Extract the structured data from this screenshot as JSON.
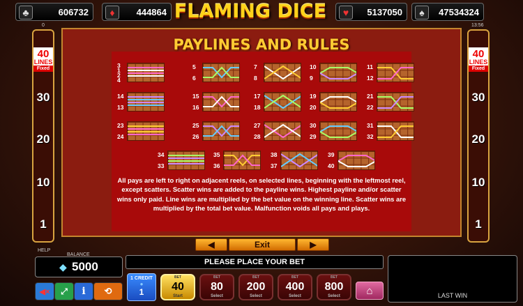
{
  "top": {
    "jackpots": [
      {
        "icon": "club-icon",
        "value": "606732"
      },
      {
        "icon": "diamond-icon",
        "value": "444864"
      },
      {
        "icon": "heart-icon",
        "value": "5137050"
      },
      {
        "icon": "spade-icon",
        "value": "47534324"
      }
    ],
    "title": "FLAMING DICE",
    "left_small": "0",
    "clock": "13:56"
  },
  "sides": {
    "lines": "40",
    "lines_label": "LINES",
    "fixed": "Fixed",
    "levels": [
      "30",
      "20",
      "10",
      "1"
    ]
  },
  "panel": {
    "title": "PAYLINES AND RULES",
    "rules": "All pays are left to right on adjacent reels, on selected lines, beginning with the leftmost reel, except scatters. Scatter wins are added to the payline wins. Highest payline and/or scatter wins only paid. Line wins are multiplied by the bet value on the winning line. Scatter wins are multiplied by the total bet value. Malfunction voids all pays and plays.",
    "paylines": [
      {
        "labels": [
          "3",
          "1",
          "2",
          "4"
        ]
      },
      {
        "labels": [
          "5",
          "6"
        ]
      },
      {
        "labels": [
          "7",
          "8"
        ]
      },
      {
        "labels": [
          "10",
          "9"
        ]
      },
      {
        "labels": [
          "11",
          "12"
        ]
      },
      {
        "labels": [
          "14",
          "13"
        ]
      },
      {
        "labels": [
          "15",
          "16"
        ]
      },
      {
        "labels": [
          "17",
          "18"
        ]
      },
      {
        "labels": [
          "19",
          "20"
        ]
      },
      {
        "labels": [
          "21",
          "22"
        ]
      },
      {
        "labels": [
          "23",
          "24"
        ]
      },
      {
        "labels": [
          "25",
          "26"
        ]
      },
      {
        "labels": [
          "27",
          "28"
        ]
      },
      {
        "labels": [
          "30",
          "29"
        ]
      },
      {
        "labels": [
          "31",
          "32"
        ]
      },
      {
        "labels": [
          "34",
          "33"
        ]
      },
      {
        "labels": [
          "35",
          "36"
        ]
      },
      {
        "labels": [
          "38",
          "37"
        ]
      },
      {
        "labels": [
          "39",
          "40"
        ]
      }
    ]
  },
  "nav": {
    "prev": "◀",
    "exit": "Exit",
    "next": "▶"
  },
  "bottom": {
    "help": "HELP",
    "balance_label": "BALANCE",
    "balance": "5000",
    "message": "PLEASE PLACE YOUR BET",
    "credit_label": "1 CREDIT",
    "credit_value": "1",
    "bet_label": "BET",
    "bet_value": "40",
    "start": "Start",
    "bets": [
      "80",
      "200",
      "400",
      "800"
    ],
    "select": "Select",
    "last_win": "LAST WIN"
  },
  "colors": {
    "panel": "#8b1c10",
    "content": "#a80a0a",
    "accent": "#ffcc33",
    "frame": "#c4862e"
  }
}
